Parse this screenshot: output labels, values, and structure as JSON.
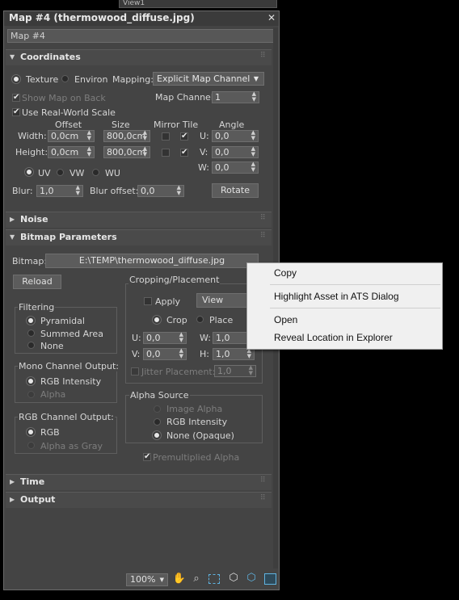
{
  "viewport_tab": "View1",
  "window": {
    "title": "Map #4 (thermowood_diffuse.jpg)",
    "close": "✕",
    "map_name": "Map #4"
  },
  "coordinates": {
    "header": "Coordinates",
    "texture": "Texture",
    "environ": "Environ",
    "mapping_label": "Mapping:",
    "mapping_value": "Explicit Map Channel",
    "show_map_on_back": "Show Map on Back",
    "map_channel_label": "Map Channel:",
    "map_channel_value": "1",
    "use_real_world_scale": "Use Real-World Scale",
    "col_offset": "Offset",
    "col_size": "Size",
    "col_mirror_tile": "Mirror Tile",
    "col_angle": "Angle",
    "width_label": "Width:",
    "height_label": "Height:",
    "width_offset": "0,0cm",
    "width_size": "800,0cm",
    "height_offset": "0,0cm",
    "height_size": "800,0cm",
    "u_label": "U:",
    "v_label": "V:",
    "w_label": "W:",
    "angle_u": "0,0",
    "angle_v": "0,0",
    "angle_w": "0,0",
    "uv": "UV",
    "vw": "VW",
    "wu": "WU",
    "blur_label": "Blur:",
    "blur_value": "1,0",
    "blur_offset_label": "Blur offset:",
    "blur_offset_value": "0,0",
    "rotate": "Rotate"
  },
  "noise": {
    "header": "Noise"
  },
  "bitmap": {
    "header": "Bitmap Parameters",
    "bitmap_label": "Bitmap:",
    "bitmap_path": "E:\\TEMP\\thermowood_diffuse.jpg",
    "reload": "Reload",
    "cropping_title": "Cropping/Placement",
    "apply": "Apply",
    "view_image": "View Image",
    "crop": "Crop",
    "place": "Place",
    "u_label": "U:",
    "v_label": "V:",
    "w_label": "W:",
    "h_label": "H:",
    "u_value": "0,0",
    "v_value": "0,0",
    "w_value": "1,0",
    "h_value": "1,0",
    "jitter_label": "Jitter Placement:",
    "jitter_value": "1,0",
    "filtering_title": "Filtering",
    "pyramidal": "Pyramidal",
    "summed_area": "Summed Area",
    "none": "None",
    "mono_title": "Mono Channel Output:",
    "rgb_intensity": "RGB Intensity",
    "alpha": "Alpha",
    "rgb_title": "RGB Channel Output:",
    "rgb": "RGB",
    "alpha_as_gray": "Alpha as Gray",
    "alpha_source_title": "Alpha Source",
    "image_alpha": "Image Alpha",
    "alpha_rgb_intensity": "RGB Intensity",
    "none_opaque": "None (Opaque)",
    "premultiplied_alpha": "Premultiplied Alpha"
  },
  "time": {
    "header": "Time"
  },
  "output": {
    "header": "Output"
  },
  "context_menu": {
    "copy": "Copy",
    "highlight": "Highlight Asset in ATS Dialog",
    "open": "Open",
    "reveal": "Reveal Location in Explorer"
  },
  "bottom": {
    "zoom": "100%"
  }
}
